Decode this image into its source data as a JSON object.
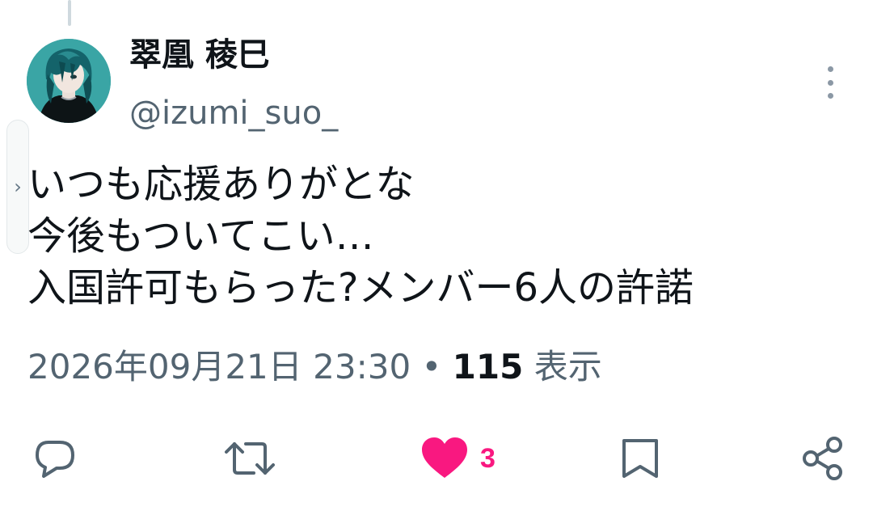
{
  "author": {
    "display_name": "翠凰 稜巳",
    "handle": "@izumi_suo_"
  },
  "tweet": {
    "lines": [
      "いつも応援ありがとな",
      "今後もついてこい…",
      "入国許可もらった?メンバー6人の許諾"
    ]
  },
  "meta": {
    "timestamp": "2026年09月21日 23:30",
    "separator": "•",
    "views_count": "115",
    "views_label": "表示"
  },
  "actions": {
    "reply_icon": "reply-icon",
    "retweet_icon": "retweet-icon",
    "like_icon": "heart-icon",
    "like_count": "3",
    "bookmark_icon": "bookmark-icon",
    "share_icon": "share-icon"
  },
  "colors": {
    "like_active": "#f91880",
    "secondary_text": "#536471",
    "primary_text": "#0f1419"
  }
}
